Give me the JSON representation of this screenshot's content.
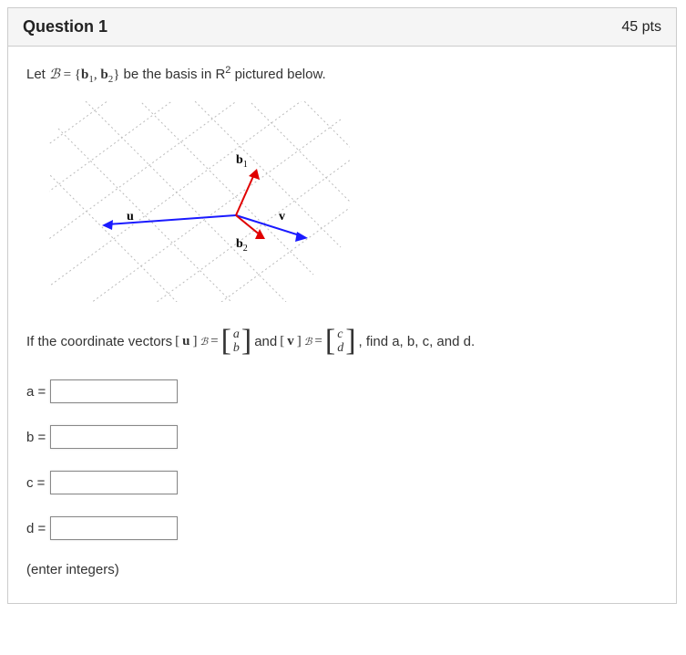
{
  "header": {
    "title": "Question 1",
    "points": "45 pts"
  },
  "prompt": {
    "pre": "Let ",
    "B": "ℬ",
    "eq": " = ",
    "lb": "{",
    "b1": "b",
    "b1s": "1",
    "comma": ", ",
    "b2": "b",
    "b2s": "2",
    "rb": "}",
    "post": " be the basis in R",
    "sup": "2",
    "postsup": " pictured below."
  },
  "plot": {
    "b1": "b",
    "b1s": "1",
    "b2": "b",
    "b2s": "2",
    "u": "u",
    "v": "v"
  },
  "eq": {
    "pre": "If the coordinate vectors ",
    "open1": "[",
    "u": "u",
    "close1": "]",
    "sub1": "ℬ",
    "eq1": " = ",
    "a": "a",
    "b": "b",
    "and": " and ",
    "open2": "[",
    "v": "v",
    "close2": "]",
    "sub2": "ℬ",
    "eq2": " = ",
    "c": "c",
    "d": "d",
    "post": ", find a, b, c, and d."
  },
  "inputs": {
    "a": {
      "label": "a ="
    },
    "b": {
      "label": "b ="
    },
    "c": {
      "label": "c ="
    },
    "d": {
      "label": "d ="
    }
  },
  "hint": "(enter integers)"
}
